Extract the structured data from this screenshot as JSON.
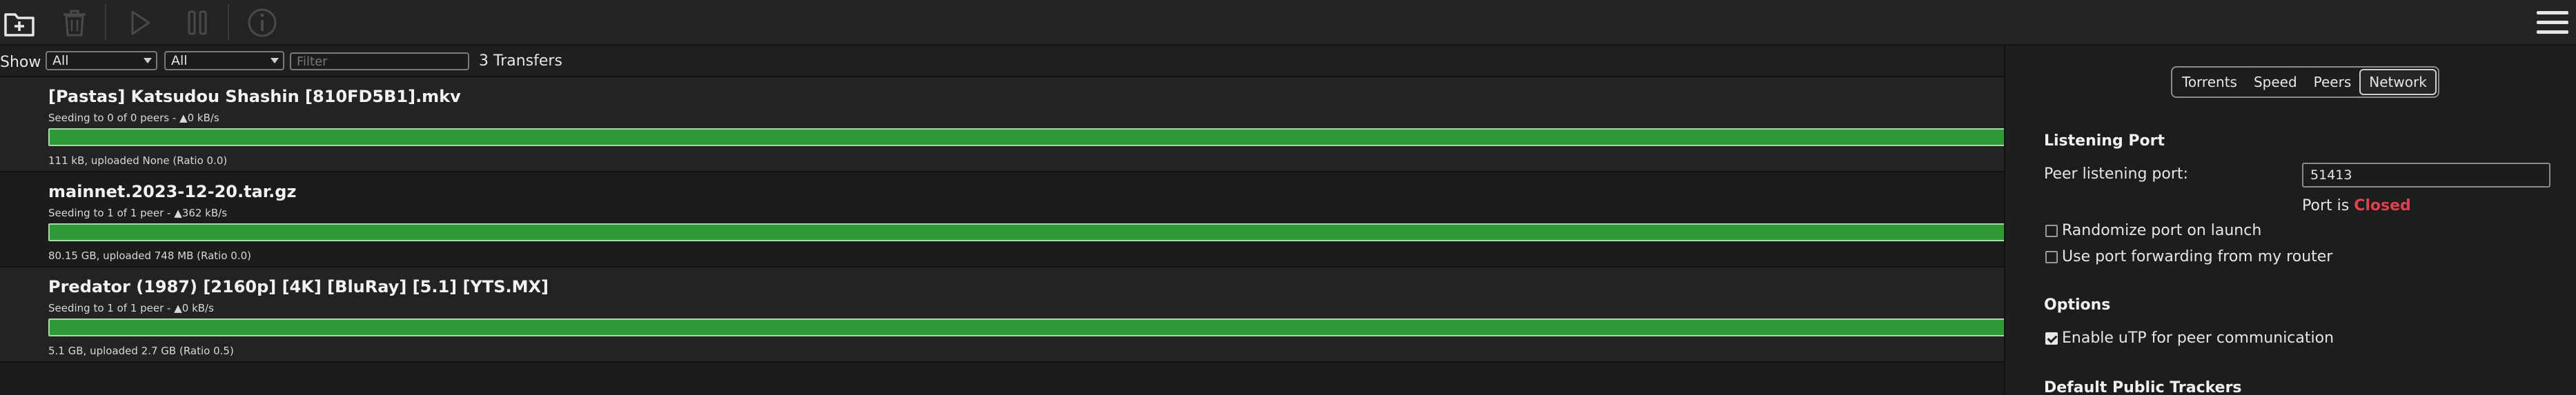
{
  "toolbar": {
    "icons": [
      "add-torrent-icon",
      "trash-icon",
      "play-icon",
      "pause-icon",
      "info-icon",
      "menu-icon"
    ]
  },
  "filterbar": {
    "show_label": "Show",
    "status_select": "All",
    "tracker_select": "All",
    "filter_placeholder": "Filter",
    "transfer_count": "3 Transfers"
  },
  "torrents": [
    {
      "name": "[Pastas] Katsudou Shashin [810FD5B1].mkv",
      "peers": "Seeding to 0 of 0 peers - ▲0 kB/s",
      "progress": 1.0,
      "stats": "111 kB, uploaded None (Ratio 0.0)"
    },
    {
      "name": "mainnet.2023-12-20.tar.gz",
      "peers": "Seeding to 1 of 1 peer - ▲362 kB/s",
      "progress": 1.0,
      "stats": "80.15 GB, uploaded 748 MB (Ratio 0.0)"
    },
    {
      "name": "Predator (1987) [2160p] [4K] [BluRay] [5.1] [YTS.MX]",
      "peers": "Seeding to 1 of 1 peer - ▲0 kB/s",
      "progress": 1.0,
      "stats": "5.1 GB, uploaded 2.7 GB (Ratio 0.5)"
    }
  ],
  "prefs": {
    "tabs": [
      "Torrents",
      "Speed",
      "Peers",
      "Network"
    ],
    "active_tab": "Network",
    "listening_port_title": "Listening Port",
    "peer_port_label": "Peer listening port:",
    "peer_port_value": "51413",
    "port_is_label": "Port is",
    "port_status": "Closed",
    "randomize_label": "Randomize port on launch",
    "randomize_checked": false,
    "port_forwarding_label": "Use port forwarding from my router",
    "port_forwarding_checked": false,
    "options_title": "Options",
    "utp_label": "Enable uTP for peer communication",
    "utp_checked": true,
    "trackers_title": "Default Public Trackers"
  },
  "colors": {
    "progress_green": "#2e9a37",
    "closed_red": "#e0404f"
  }
}
